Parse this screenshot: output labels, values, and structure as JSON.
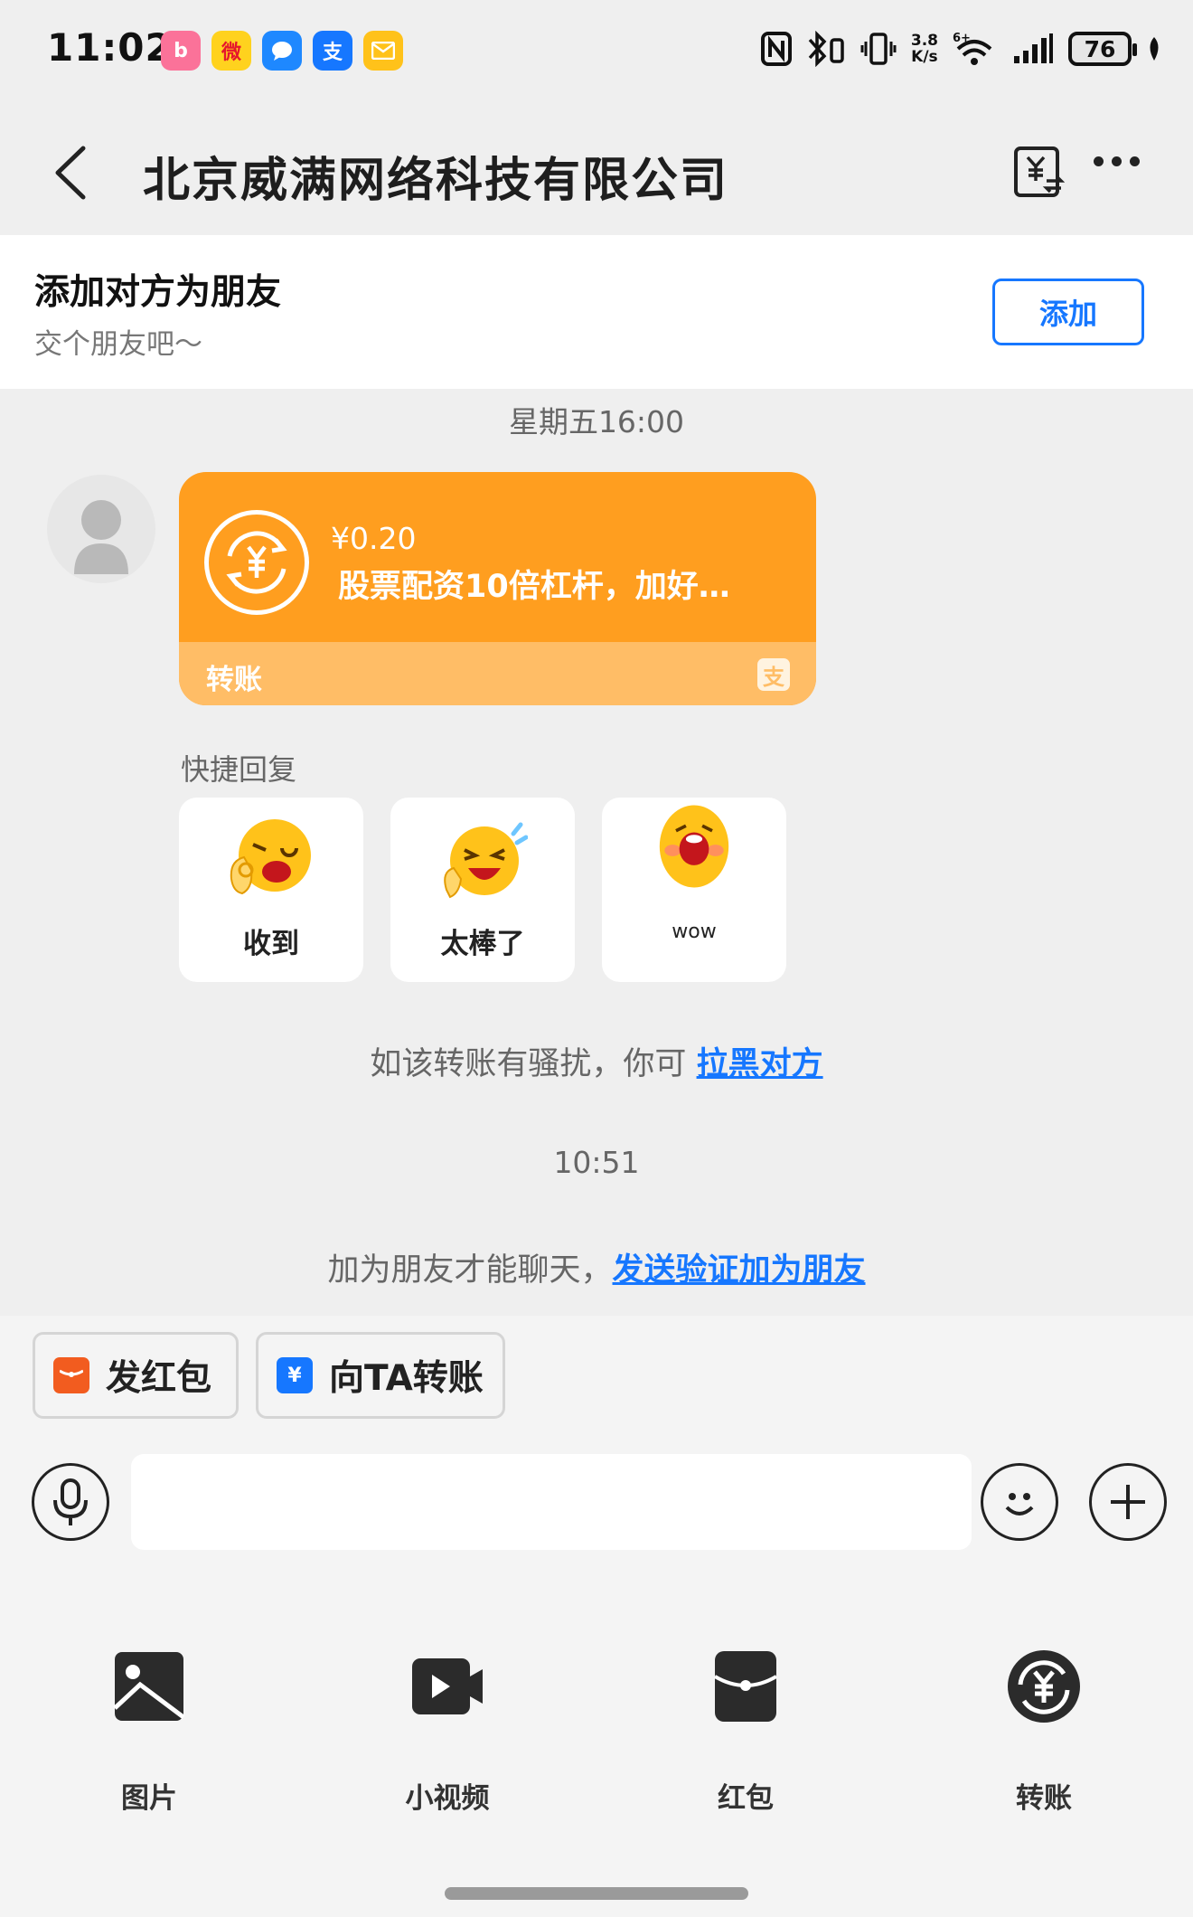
{
  "status_bar": {
    "time": "11:02",
    "net_speed_value": "3.8",
    "net_speed_unit": "K/s",
    "network_tag": "6+",
    "battery": "76",
    "app_icons": [
      "bilibili-icon",
      "weibo-icon",
      "messages-icon",
      "alipay-icon",
      "mail-icon"
    ]
  },
  "header": {
    "title": "北京威满网络科技有限公司",
    "back_icon": "chevron-left-icon",
    "transfer_icon": "yuan-transfer-icon",
    "more_icon": "more-dots-icon"
  },
  "add_friend": {
    "heading": "添加对方为朋友",
    "subtext": "交个朋友吧～",
    "button_label": "添加"
  },
  "chat": {
    "timestamp_1": "星期五16:00",
    "transfer_card": {
      "amount": "¥0.20",
      "message": "股票配资10倍杠杆，加好…",
      "footer_label": "转账",
      "footer_logo": "支",
      "accent_color": "#ff9e1f"
    },
    "quick_reply": {
      "title": "快捷回复",
      "items": [
        {
          "label": "收到",
          "icon": "ok-emoji-icon"
        },
        {
          "label": "太棒了",
          "icon": "laugh-cry-emoji-icon"
        },
        {
          "label": "wow",
          "icon": "wow-emoji-icon"
        }
      ]
    },
    "harass_notice": {
      "text": "如该转账有骚扰，你可 ",
      "link": "拉黑对方"
    },
    "timestamp_2": "10:51",
    "friend_notice": {
      "text": "加为朋友才能聊天，",
      "link": "发送验证加为朋友"
    }
  },
  "actions": {
    "red_packet_chip": "发红包",
    "transfer_chip": "向TA转账"
  },
  "input_bar": {
    "placeholder": "",
    "voice_icon": "microphone-icon",
    "emoji_icon": "smiley-icon",
    "plus_icon": "plus-icon"
  },
  "tools": [
    {
      "label": "图片",
      "icon": "image-icon"
    },
    {
      "label": "小视频",
      "icon": "video-icon"
    },
    {
      "label": "红包",
      "icon": "red-packet-icon"
    },
    {
      "label": "转账",
      "icon": "transfer-icon"
    }
  ],
  "colors": {
    "link": "#1677ff",
    "background": "#efefef",
    "card_orange": "#ff9e1f"
  }
}
